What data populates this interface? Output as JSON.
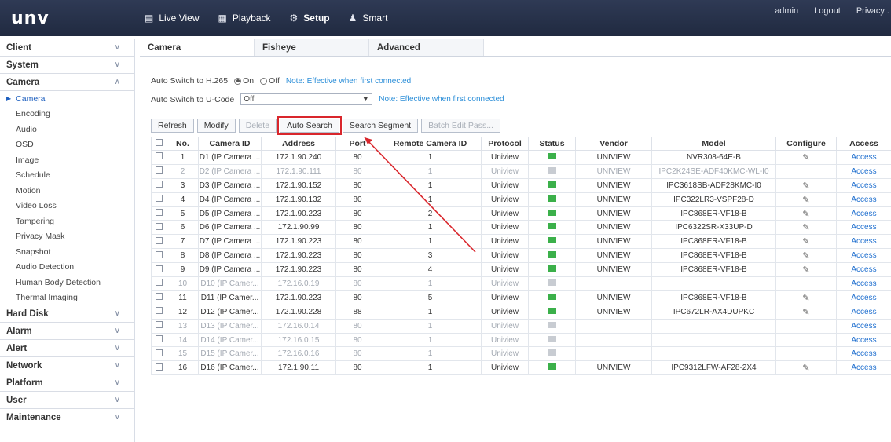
{
  "header": {
    "logo": "unv",
    "nav": [
      {
        "label": "Live View",
        "icon": "monitor-icon"
      },
      {
        "label": "Playback",
        "icon": "film-icon"
      },
      {
        "label": "Setup",
        "icon": "gear-icon"
      },
      {
        "label": "Smart",
        "icon": "person-icon"
      }
    ],
    "user": "admin",
    "logout": "Logout",
    "privacy": "Privacy ."
  },
  "sidebar": {
    "groups_top": [
      "Client",
      "System"
    ],
    "camera_group": "Camera",
    "camera_items": [
      "Camera",
      "Encoding",
      "Audio",
      "OSD",
      "Image",
      "Schedule",
      "Motion",
      "Video Loss",
      "Tampering",
      "Privacy Mask",
      "Snapshot",
      "Audio Detection",
      "Human Body Detection",
      "Thermal Imaging"
    ],
    "groups_bottom": [
      "Hard Disk",
      "Alarm",
      "Alert",
      "Network",
      "Platform",
      "User",
      "Maintenance"
    ]
  },
  "tabs": [
    "Camera",
    "Fisheye",
    "Advanced"
  ],
  "options": {
    "h265_label": "Auto Switch to H.265",
    "on": "On",
    "off": "Off",
    "h265_note": "Note: Effective when first connected",
    "ucode_label": "Auto Switch to U-Code",
    "ucode_value": "Off",
    "ucode_note": "Note: Effective when first connected"
  },
  "toolbar": {
    "refresh": "Refresh",
    "modify": "Modify",
    "delete": "Delete",
    "auto_search": "Auto Search",
    "search_segment": "Search Segment",
    "batch_edit": "Batch Edit Pass..."
  },
  "table": {
    "columns": [
      "No.",
      "Camera ID",
      "Address",
      "Port",
      "Remote Camera ID",
      "Protocol",
      "Status",
      "Vendor",
      "Model",
      "Configure",
      "Access"
    ],
    "rows": [
      {
        "no": "1",
        "id": "D1 (IP Camera ...",
        "address": "172.1.90.240",
        "port": "80",
        "remote": "1",
        "protocol": "Uniview",
        "online": true,
        "vendor": "UNIVIEW",
        "model": "NVR308-64E-B",
        "configure": true,
        "access": "Access",
        "dim": false
      },
      {
        "no": "2",
        "id": "D2 (IP Camera ...",
        "address": "172.1.90.111",
        "port": "80",
        "remote": "1",
        "protocol": "Uniview",
        "online": false,
        "vendor": "UNIVIEW",
        "model": "IPC2K24SE-ADF40KMC-WL-I0",
        "configure": false,
        "access": "Access",
        "dim": true
      },
      {
        "no": "3",
        "id": "D3 (IP Camera ...",
        "address": "172.1.90.152",
        "port": "80",
        "remote": "1",
        "protocol": "Uniview",
        "online": true,
        "vendor": "UNIVIEW",
        "model": "IPC3618SB-ADF28KMC-I0",
        "configure": true,
        "access": "Access",
        "dim": false
      },
      {
        "no": "4",
        "id": "D4 (IP Camera ...",
        "address": "172.1.90.132",
        "port": "80",
        "remote": "1",
        "protocol": "Uniview",
        "online": true,
        "vendor": "UNIVIEW",
        "model": "IPC322LR3-VSPF28-D",
        "configure": true,
        "access": "Access",
        "dim": false
      },
      {
        "no": "5",
        "id": "D5 (IP Camera ...",
        "address": "172.1.90.223",
        "port": "80",
        "remote": "2",
        "protocol": "Uniview",
        "online": true,
        "vendor": "UNIVIEW",
        "model": "IPC868ER-VF18-B",
        "configure": true,
        "access": "Access",
        "dim": false
      },
      {
        "no": "6",
        "id": "D6 (IP Camera ...",
        "address": "172.1.90.99",
        "port": "80",
        "remote": "1",
        "protocol": "Uniview",
        "online": true,
        "vendor": "UNIVIEW",
        "model": "IPC6322SR-X33UP-D",
        "configure": true,
        "access": "Access",
        "dim": false
      },
      {
        "no": "7",
        "id": "D7 (IP Camera ...",
        "address": "172.1.90.223",
        "port": "80",
        "remote": "1",
        "protocol": "Uniview",
        "online": true,
        "vendor": "UNIVIEW",
        "model": "IPC868ER-VF18-B",
        "configure": true,
        "access": "Access",
        "dim": false
      },
      {
        "no": "8",
        "id": "D8 (IP Camera ...",
        "address": "172.1.90.223",
        "port": "80",
        "remote": "3",
        "protocol": "Uniview",
        "online": true,
        "vendor": "UNIVIEW",
        "model": "IPC868ER-VF18-B",
        "configure": true,
        "access": "Access",
        "dim": false
      },
      {
        "no": "9",
        "id": "D9 (IP Camera ...",
        "address": "172.1.90.223",
        "port": "80",
        "remote": "4",
        "protocol": "Uniview",
        "online": true,
        "vendor": "UNIVIEW",
        "model": "IPC868ER-VF18-B",
        "configure": true,
        "access": "Access",
        "dim": false
      },
      {
        "no": "10",
        "id": "D10 (IP Camer...",
        "address": "172.16.0.19",
        "port": "80",
        "remote": "1",
        "protocol": "Uniview",
        "online": false,
        "vendor": "",
        "model": "",
        "configure": false,
        "access": "Access",
        "dim": true
      },
      {
        "no": "11",
        "id": "D11 (IP Camer...",
        "address": "172.1.90.223",
        "port": "80",
        "remote": "5",
        "protocol": "Uniview",
        "online": true,
        "vendor": "UNIVIEW",
        "model": "IPC868ER-VF18-B",
        "configure": true,
        "access": "Access",
        "dim": false
      },
      {
        "no": "12",
        "id": "D12 (IP Camer...",
        "address": "172.1.90.228",
        "port": "88",
        "remote": "1",
        "protocol": "Uniview",
        "online": true,
        "vendor": "UNIVIEW",
        "model": "IPC672LR-AX4DUPKC",
        "configure": true,
        "access": "Access",
        "dim": false
      },
      {
        "no": "13",
        "id": "D13 (IP Camer...",
        "address": "172.16.0.14",
        "port": "80",
        "remote": "1",
        "protocol": "Uniview",
        "online": false,
        "vendor": "",
        "model": "",
        "configure": false,
        "access": "Access",
        "dim": true
      },
      {
        "no": "14",
        "id": "D14 (IP Camer...",
        "address": "172.16.0.15",
        "port": "80",
        "remote": "1",
        "protocol": "Uniview",
        "online": false,
        "vendor": "",
        "model": "",
        "configure": false,
        "access": "Access",
        "dim": true
      },
      {
        "no": "15",
        "id": "D15 (IP Camer...",
        "address": "172.16.0.16",
        "port": "80",
        "remote": "1",
        "protocol": "Uniview",
        "online": false,
        "vendor": "",
        "model": "",
        "configure": false,
        "access": "Access",
        "dim": true
      },
      {
        "no": "16",
        "id": "D16 (IP Camer...",
        "address": "172.1.90.11",
        "port": "80",
        "remote": "1",
        "protocol": "Uniview",
        "online": true,
        "vendor": "UNIVIEW",
        "model": "IPC9312LFW-AF28-2X4",
        "configure": true,
        "access": "Access",
        "dim": false
      }
    ]
  },
  "colors": {
    "header_bg": "#26304a",
    "accent_blue": "#1d5fbf",
    "status_online": "#3bb04a",
    "highlight_red": "#d9262c"
  }
}
